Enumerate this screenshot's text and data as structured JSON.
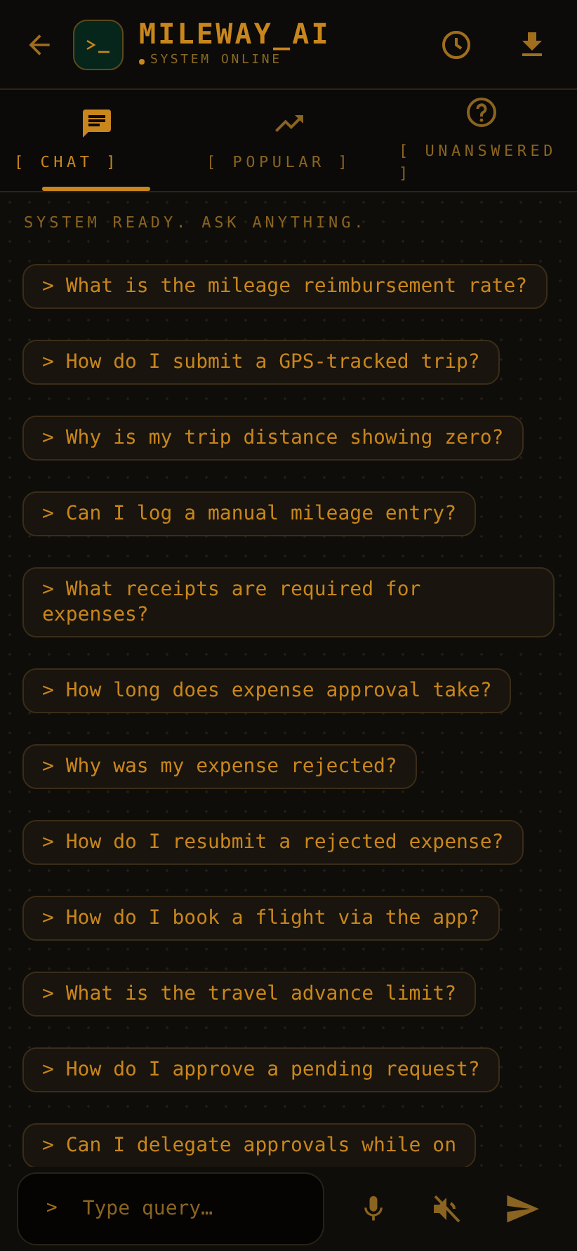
{
  "header": {
    "title": "MILEWAY_AI",
    "status": "SYSTEM ONLINE",
    "online": true
  },
  "tabs": [
    {
      "label": "[ CHAT ]",
      "kind": "chat",
      "selected": true
    },
    {
      "label": "[ POPULAR ]",
      "kind": "trending",
      "selected": false
    },
    {
      "label": "[ UNANSWERED ]",
      "kind": "help",
      "selected": false
    }
  ],
  "intro": "SYSTEM READY. ASK ANYTHING.",
  "suggestions": [
    "> What is the mileage reimbursement rate?",
    "> How do I submit a GPS-tracked trip?",
    "> Why is my trip distance showing zero?",
    "> Can I log a manual mileage entry?",
    "> What receipts are required for expenses?",
    "> How long does expense approval take?",
    "> Why was my expense rejected?",
    "> How do I resubmit a rejected expense?",
    "> How do I book a flight via the app?",
    "> What is the travel advance limit?",
    "> How do I approve a pending request?",
    "> Can I delegate approvals while on"
  ],
  "composer": {
    "prompt": ">",
    "placeholder": "Type query…",
    "muted": true
  }
}
